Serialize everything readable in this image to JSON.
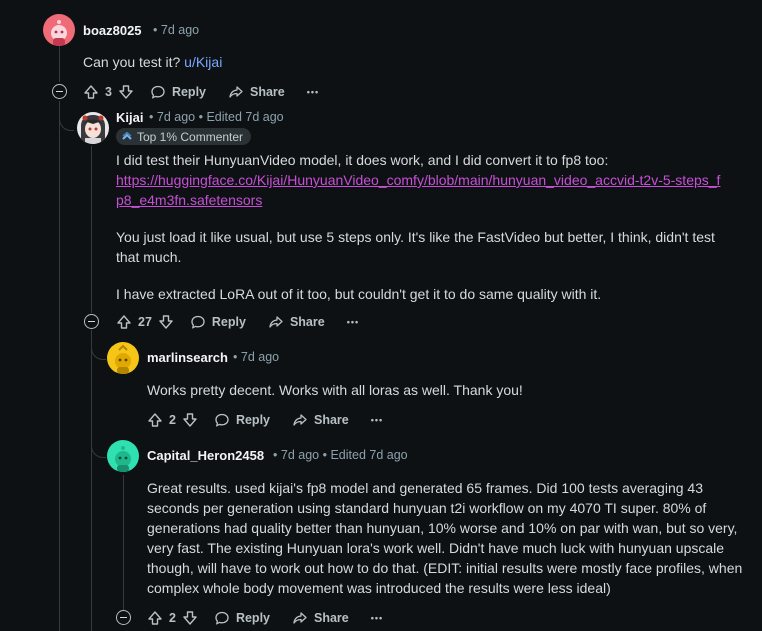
{
  "comments": [
    {
      "author": "boaz8025",
      "time": "7d ago",
      "body_prefix": "Can you test it? ",
      "body_mention": "u/Kijai",
      "votes": "3",
      "reply": "Reply",
      "share": "Share"
    },
    {
      "author": "Kijai",
      "time": "7d ago",
      "edited": "Edited 7d ago",
      "flair": "Top 1% Commenter",
      "para1": "I did test their HunyuanVideo model, it does work, and I did convert it to fp8 too:",
      "link": "https://huggingface.co/Kijai/HunyuanVideo_comfy/blob/main/hunyuan_video_accvid-t2v-5-steps_fp8_e4m3fn.safetensors",
      "para2": "You just load it like usual, but use 5 steps only. It's like the FastVideo but better, I think, didn't test that much.",
      "para3": "I have extracted LoRA out of it too, but couldn't get it to do same quality with it.",
      "votes": "27",
      "reply": "Reply",
      "share": "Share"
    },
    {
      "author": "marlinsearch",
      "time": "7d ago",
      "body": "Works pretty decent. Works with all loras as well. Thank you!",
      "votes": "2",
      "reply": "Reply",
      "share": "Share"
    },
    {
      "author": "Capital_Heron2458",
      "time": "7d ago",
      "edited": "Edited 7d ago",
      "body": "Great results. used kijai's fp8 model and generated 65 frames. Did 100 tests averaging 43 seconds per generation using standard hunyuan t2i workflow on my 4070 TI super. 80% of generations had quality better than hunyuan, 10% worse and 10% on par with wan, but so very, very fast. The existing Hunyuan lora's work well. Didn't have much luck with hunyuan upscale though, will have to work out how to do that. (EDIT: initial results were mostly face profiles, when complex whole body movement was introduced the results were less ideal)",
      "votes": "2",
      "reply": "Reply",
      "share": "Share"
    }
  ],
  "ui": {
    "dot": "•",
    "more": "•••"
  },
  "colors": {
    "avatar1": "#f06b78",
    "avatar3": "#f5c518",
    "avatar4": "#2fe0b0",
    "mention": "#7aa7ff",
    "link": "#c74fd6"
  },
  "icons": [
    "upvote-icon",
    "downvote-icon",
    "reply-icon",
    "share-icon",
    "more-icon",
    "collapse-icon",
    "flair-icon"
  ]
}
